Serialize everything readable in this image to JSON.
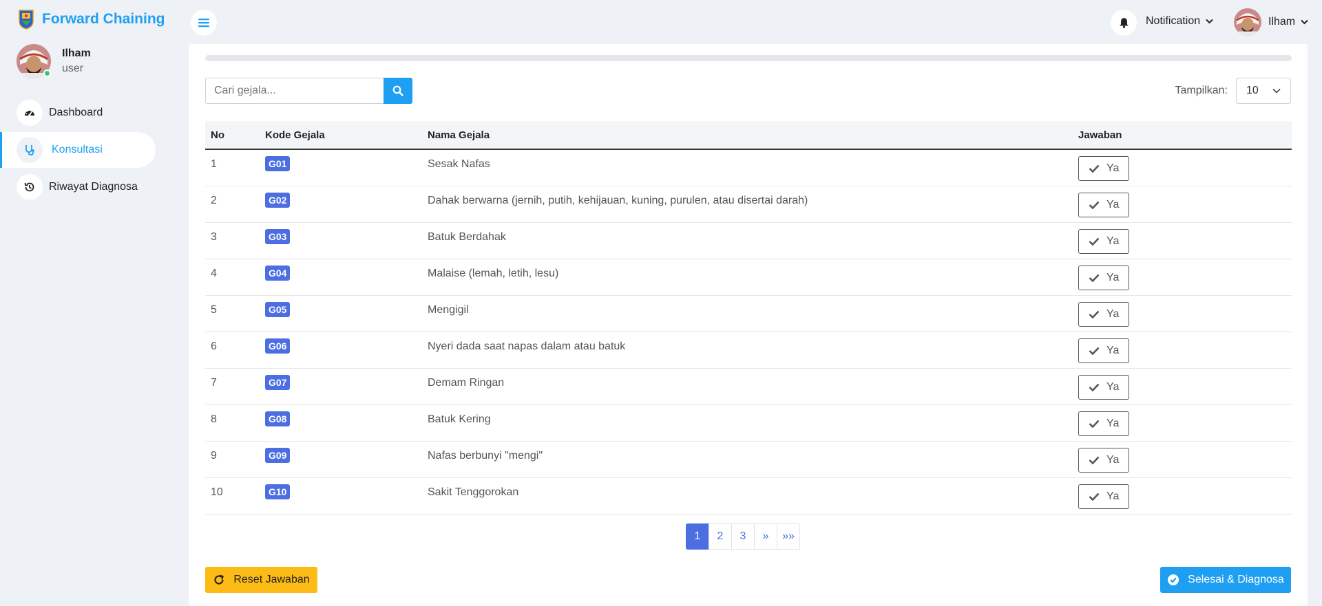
{
  "brand": {
    "title": "Forward Chaining"
  },
  "sidebar": {
    "user": {
      "name": "Ilham",
      "role": "user"
    },
    "items": [
      {
        "label": "Dashboard",
        "icon": "speedometer-icon",
        "active": false
      },
      {
        "label": "Konsultasi",
        "icon": "stethoscope-icon",
        "active": true
      },
      {
        "label": "Riwayat Diagnosa",
        "icon": "history-icon",
        "active": false
      }
    ]
  },
  "topbar": {
    "notification_label": "Notification",
    "user_name": "Ilham"
  },
  "search": {
    "placeholder": "Cari gejala..."
  },
  "show": {
    "label": "Tampilkan:",
    "value": "10"
  },
  "table": {
    "headers": {
      "no": "No",
      "kode": "Kode Gejala",
      "nama": "Nama Gejala",
      "jawaban": "Jawaban"
    },
    "rows": [
      {
        "no": "1",
        "kode": "G01",
        "nama": "Sesak Nafas",
        "jawaban": "Ya"
      },
      {
        "no": "2",
        "kode": "G02",
        "nama": "Dahak berwarna (jernih, putih, kehijauan, kuning, purulen, atau disertai darah)",
        "jawaban": "Ya"
      },
      {
        "no": "3",
        "kode": "G03",
        "nama": "Batuk Berdahak",
        "jawaban": "Ya"
      },
      {
        "no": "4",
        "kode": "G04",
        "nama": "Malaise (lemah, letih, lesu)",
        "jawaban": "Ya"
      },
      {
        "no": "5",
        "kode": "G05",
        "nama": "Mengigil",
        "jawaban": "Ya"
      },
      {
        "no": "6",
        "kode": "G06",
        "nama": "Nyeri dada saat napas dalam atau batuk",
        "jawaban": "Ya"
      },
      {
        "no": "7",
        "kode": "G07",
        "nama": "Demam Ringan",
        "jawaban": "Ya"
      },
      {
        "no": "8",
        "kode": "G08",
        "nama": "Batuk Kering",
        "jawaban": "Ya"
      },
      {
        "no": "9",
        "kode": "G09",
        "nama": "Nafas berbunyi \"mengi\"",
        "jawaban": "Ya"
      },
      {
        "no": "10",
        "kode": "G10",
        "nama": "Sakit Tenggorokan",
        "jawaban": "Ya"
      }
    ]
  },
  "pagination": {
    "pages": [
      "1",
      "2",
      "3",
      "»",
      "»»"
    ],
    "active": "1"
  },
  "actions": {
    "reset_label": "Reset Jawaban",
    "finish_label": "Selesai & Diagnosa"
  },
  "colors": {
    "accent": "#1e9ff2",
    "badge": "#4c6ee0",
    "warning": "#fdbc15"
  }
}
